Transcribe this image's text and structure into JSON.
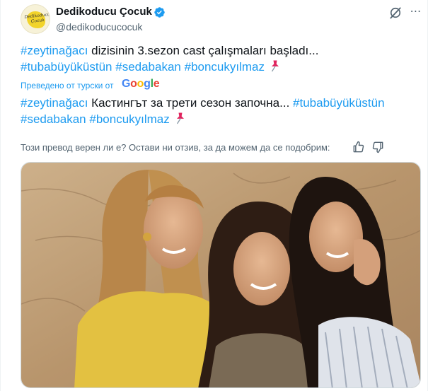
{
  "author": {
    "display_name": "Dedikoducu Çocuk",
    "handle": "@dedikoducucocuk",
    "avatar_text": "Dedikoducu Çocuk",
    "verified_icon": "verified-badge-icon"
  },
  "header": {
    "grok_icon": "grok-icon",
    "more_icon": "more-options-icon"
  },
  "tweet": {
    "tag1": "#zeytinağacı",
    "text1": " dizisinin 3.sezon cast çalışmaları başladı...",
    "tag2": "#tubabüyüküstün",
    "tag3": "#sedabakan",
    "tag4": "#boncukyılmaz"
  },
  "translation": {
    "label": "Преведено от турски от",
    "provider": [
      "G",
      "o",
      "o",
      "g",
      "l",
      "e"
    ],
    "tag1": "#zeytinağacı",
    "text1": " Кастингът за трети сезон започна... ",
    "tag2": "#tubabüyüküstün",
    "tag3": "#sedabakan",
    "tag4": "#boncukyılmaz"
  },
  "feedback": {
    "prompt": "Този превод верен ли е? Остави ни отзив, за да можем да се подобрим:",
    "thumbs_up_icon": "thumbs-up-icon",
    "thumbs_down_icon": "thumbs-down-icon"
  },
  "media": {
    "description_icon": "photo-three-women"
  },
  "colors": {
    "link": "#1d9bf0",
    "text": "#0f1419",
    "muted": "#536471"
  }
}
